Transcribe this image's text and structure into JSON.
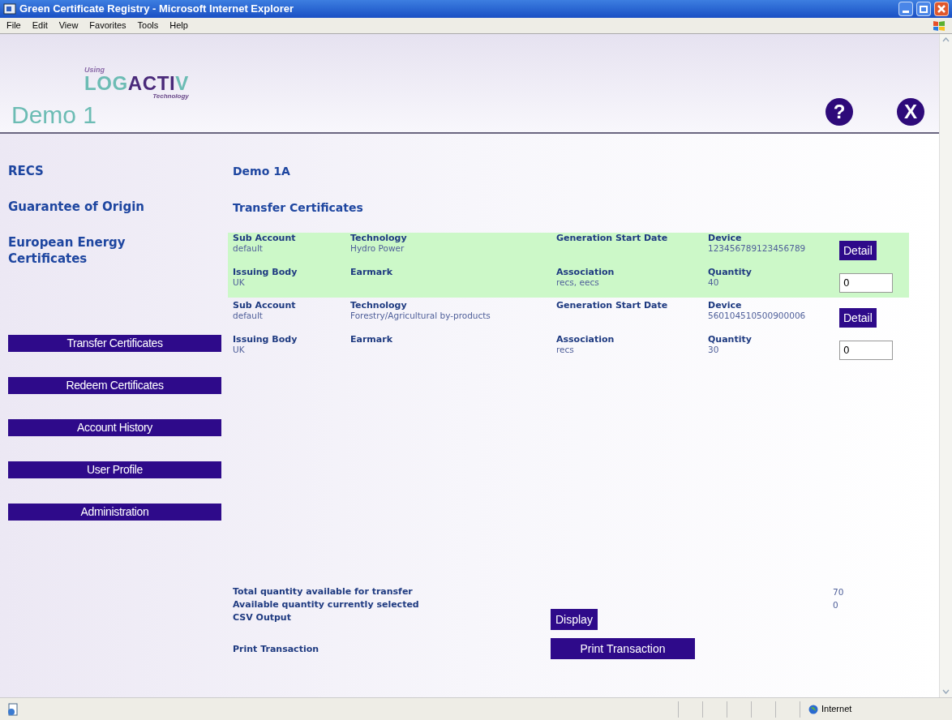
{
  "window": {
    "title": "Green Certificate Registry - Microsoft Internet Explorer"
  },
  "menu": [
    "File",
    "Edit",
    "View",
    "Favorites",
    "Tools",
    "Help"
  ],
  "header": {
    "logo": {
      "using": "Using",
      "parts": [
        {
          "text": "LOG",
          "color": "#6cbcb4"
        },
        {
          "text": "ACTI",
          "color": "#4a2a7a"
        },
        {
          "text": "V",
          "color": "#6cbcb4"
        }
      ],
      "tagline": "Technology"
    },
    "title": "Demo 1",
    "help_button": "?",
    "close_button": "X"
  },
  "sidebar": {
    "links": [
      "RECS",
      "Guarantee of Origin",
      "European Energy Certificates"
    ],
    "buttons": [
      "Transfer Certificates",
      "Redeem Certificates",
      "Account History",
      "User Profile",
      "Administration"
    ]
  },
  "main": {
    "account": "Demo 1A",
    "heading": "Transfer Certificates",
    "records": [
      {
        "selected": true,
        "top": [
          {
            "label": "Sub Account",
            "value": "default"
          },
          {
            "label": "Technology",
            "value": "Hydro Power"
          },
          {
            "label": "Generation Start Date"
          },
          {
            "label": "Device",
            "value": "123456789123456789"
          }
        ],
        "detail_button": "Detail",
        "bottom": [
          {
            "label": "Issuing Body",
            "value": "UK"
          },
          {
            "label": "Earmark"
          },
          {
            "label": "Association",
            "value": "recs, eecs"
          },
          {
            "label": "Quantity",
            "value": "40"
          }
        ],
        "input": "0"
      },
      {
        "selected": false,
        "top": [
          {
            "label": "Sub Account",
            "value": "default"
          },
          {
            "label": "Technology",
            "value": "Forestry/Agricultural by-products"
          },
          {
            "label": "Generation Start Date"
          },
          {
            "label": "Device",
            "value": "560104510500900006"
          }
        ],
        "detail_button": "Detail",
        "bottom": [
          {
            "label": "Issuing Body",
            "value": "UK"
          },
          {
            "label": "Earmark"
          },
          {
            "label": "Association",
            "value": "recs"
          },
          {
            "label": "Quantity",
            "value": "30"
          }
        ],
        "input": "0"
      }
    ],
    "totals": [
      {
        "label": "Total quantity available for transfer",
        "value": "70"
      },
      {
        "label": "Available quantity currently selected",
        "value": "0"
      }
    ],
    "csv": {
      "label": "CSV Output",
      "button": "Display"
    },
    "print": {
      "label": "Print Transaction",
      "button": "Print Transaction"
    }
  },
  "status_bar": {
    "zone": "Internet"
  }
}
